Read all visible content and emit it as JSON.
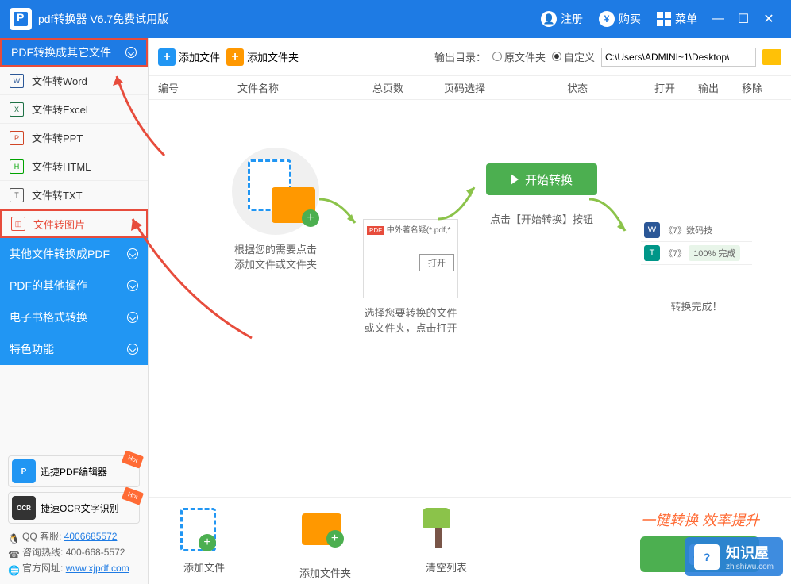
{
  "titlebar": {
    "title": "pdf转换器 V6.7免费试用版",
    "register": "注册",
    "buy": "购买",
    "menu": "菜单"
  },
  "sidebar": {
    "header": "PDF转换成其它文件",
    "items": [
      {
        "label": "文件转Word",
        "icon": "W",
        "color": "#2b5797"
      },
      {
        "label": "文件转Excel",
        "icon": "X",
        "color": "#1e7145"
      },
      {
        "label": "文件转PPT",
        "icon": "P",
        "color": "#d04525"
      },
      {
        "label": "文件转HTML",
        "icon": "H",
        "color": "#00a300"
      },
      {
        "label": "文件转TXT",
        "icon": "T",
        "color": "#555"
      },
      {
        "label": "文件转图片",
        "icon": "◫",
        "color": "#e74c3c"
      }
    ],
    "categories": [
      "其他文件转换成PDF",
      "PDF的其他操作",
      "电子书格式转换",
      "特色功能"
    ],
    "ads": [
      {
        "label": "迅捷PDF编辑器",
        "color": "#2196f3",
        "icon": "P"
      },
      {
        "label": "捷速OCR文字识别",
        "color": "#333",
        "icon": "OCR"
      }
    ],
    "contact": {
      "qq_label": "QQ 客服:",
      "qq": "4006685572",
      "phone_label": "咨询热线:",
      "phone": "400-668-5572",
      "site_label": "官方网址:",
      "site": "www.xjpdf.com"
    }
  },
  "toolbar": {
    "add_file": "添加文件",
    "add_folder": "添加文件夹",
    "output_label": "输出目录：",
    "radio_original": "原文件夹",
    "radio_custom": "自定义",
    "path": "C:\\Users\\ADMINI~1\\Desktop\\"
  },
  "table": {
    "cols": [
      "编号",
      "文件名称",
      "总页数",
      "页码选择",
      "状态",
      "打开",
      "输出",
      "移除"
    ]
  },
  "tutorial": {
    "step1": "根据您的需要点击\n添加文件或文件夹",
    "step2_file": "中外著名疑(*.pdf,*",
    "step2_open": "打开",
    "step2": "选择您要转换的文件\n或文件夹，点击打开",
    "step3_btn": "开始转换",
    "step3": "点击【开始转换】按钮",
    "step4_item1": "《7》数码技",
    "step4_item2": "《7》",
    "step4_badge": "100% 完成",
    "step4": "转换完成！"
  },
  "bottom": {
    "add_file": "添加文件",
    "add_folder": "添加文件夹",
    "clear": "清空列表",
    "promo": "一键转换  效率提升"
  },
  "watermark": {
    "name": "知识屋",
    "url": "zhishiwu.com"
  }
}
